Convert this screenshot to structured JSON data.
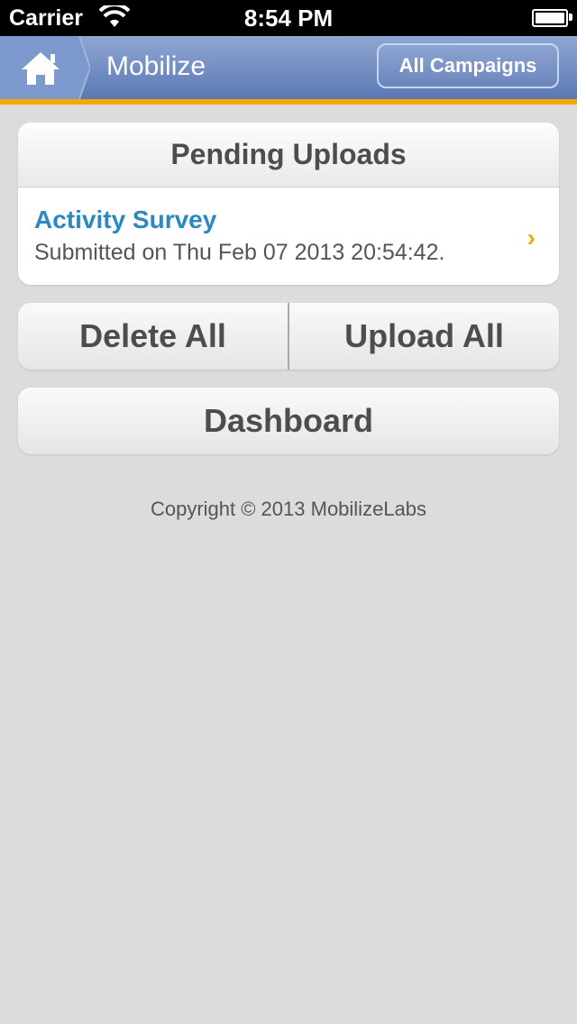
{
  "status_bar": {
    "carrier": "Carrier",
    "time": "8:54 PM",
    "wifi_icon": "wifi-icon",
    "battery_icon": "battery-icon"
  },
  "nav_bar": {
    "home_icon": "home-icon",
    "title": "Mobilize",
    "right_button_label": "All Campaigns",
    "accent_color": "#f5a900",
    "bar_color": "#6f8ac2"
  },
  "pending_uploads": {
    "header": "Pending Uploads",
    "items": [
      {
        "title": "Activity Survey",
        "subtitle": "Submitted on Thu Feb 07 2013 20:54:42.",
        "icon": "chevron-right-icon"
      }
    ]
  },
  "actions": {
    "delete_all_label": "Delete All",
    "upload_all_label": "Upload All",
    "dashboard_label": "Dashboard"
  },
  "footer": {
    "copyright": "Copyright © 2013 MobilizeLabs"
  }
}
